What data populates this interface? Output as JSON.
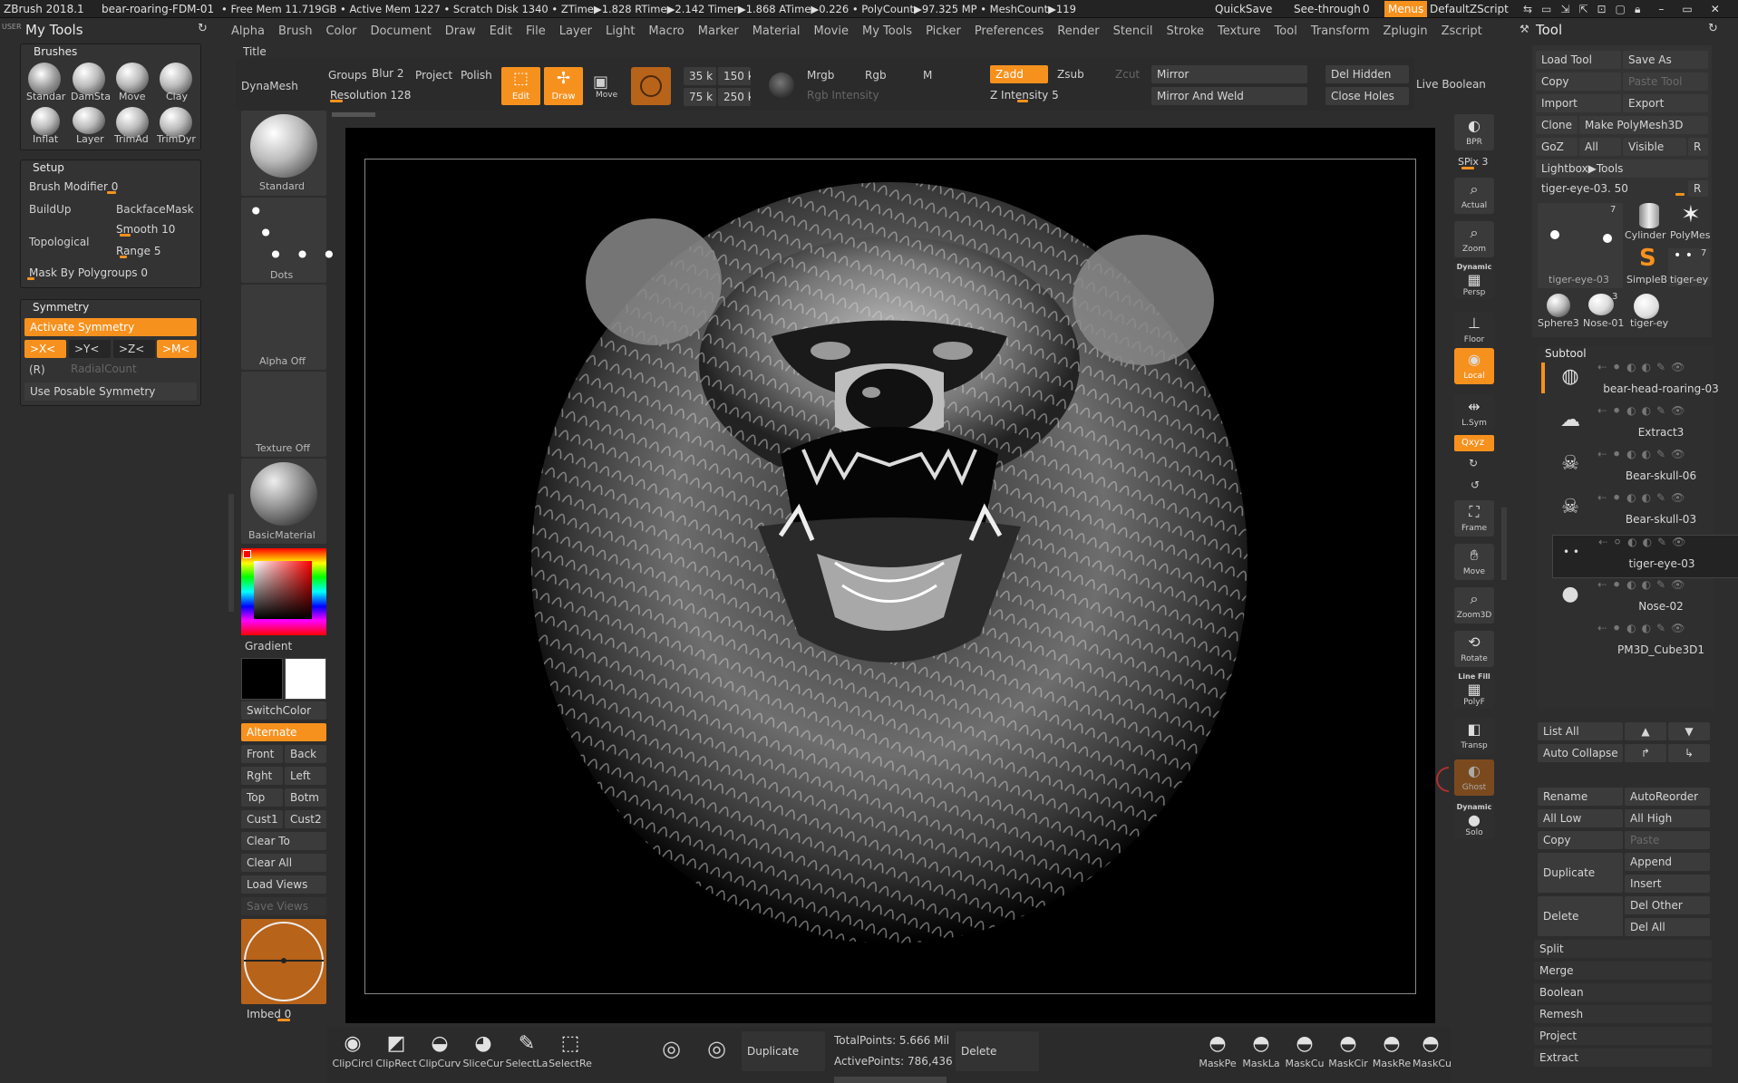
{
  "titlebar": {
    "app": "ZBrush 2018.1",
    "doc": "bear-roaring-FDM-01",
    "stats": "• Free Mem 11.719GB • Active Mem 1227 • Scratch Disk 1340 • ZTime▶1.828 RTime▶2.142 Timer▶1.868 ATime▶0.226 • PolyCount▶97.325 MP • MeshCount▶119",
    "quicksave": "QuickSave",
    "seethrough": "See-through",
    "seethrough_val": "0",
    "menus": "Menus",
    "script": "DefaultZScript"
  },
  "menu": [
    "Alpha",
    "Brush",
    "Color",
    "Document",
    "Draw",
    "Edit",
    "File",
    "Layer",
    "Light",
    "Macro",
    "Marker",
    "Material",
    "Movie",
    "My Tools",
    "Picker",
    "Preferences",
    "Render",
    "Stencil",
    "Stroke",
    "Texture",
    "Tool",
    "Transform",
    "Zplugin",
    "Zscript"
  ],
  "left": {
    "user": "USER",
    "title": "My Tools",
    "brushes_hdr": "Brushes",
    "brushes": [
      "Standar",
      "DamSta",
      "Move",
      "Clay",
      "Inflat",
      "Layer",
      "TrimAd",
      "TrimDyr"
    ],
    "setup_hdr": "Setup",
    "brush_modifier": "Brush Modifier 0",
    "buildup": "BuildUp",
    "backface": "BackfaceMask",
    "topological": "Topological",
    "smooth": "Smooth 10",
    "range": "Range 5",
    "mask_by_poly": "Mask By Polygroups 0",
    "sym_hdr": "Symmetry",
    "activate_sym": "Activate Symmetry",
    "x": ">X<",
    "y": ">Y<",
    "z": ">Z<",
    "m": ">M<",
    "r": "(R)",
    "radial": "RadialCount",
    "posable": "Use Posable Symmetry"
  },
  "top": {
    "title": "Title",
    "dynamesh": "DynaMesh",
    "groups": "Groups",
    "blur": "Blur 2",
    "project": "Project",
    "polish": "Polish",
    "resolution": "Resolution 128",
    "edit": "Edit",
    "draw": "Draw",
    "move": "Move",
    "p35k": "35 k",
    "p150k": "150 k",
    "p75k": "75 k",
    "p250k": "250 k",
    "mrgb": "Mrgb",
    "rgb": "Rgb",
    "m": "M",
    "rgb_intensity": "Rgb Intensity",
    "zadd": "Zadd",
    "zsub": "Zsub",
    "zcut": "Zcut",
    "z_intensity": "Z Intensity 5",
    "mirror": "Mirror",
    "mirror_weld": "Mirror And Weld",
    "del_hidden": "Del Hidden",
    "close_holes": "Close Holes",
    "live_boolean": "Live Boolean"
  },
  "shelf": {
    "standard": "Standard",
    "dots": "Dots",
    "alpha_off": "Alpha Off",
    "texture_off": "Texture Off",
    "material": "BasicMaterial",
    "gradient": "Gradient",
    "switchcolor": "SwitchColor",
    "alternate": "Alternate",
    "front": "Front",
    "back": "Back",
    "rght": "Rght",
    "left": "Left",
    "top": "Top",
    "botm": "Botm",
    "cust1": "Cust1",
    "cust2": "Cust2",
    "clear_to": "Clear To",
    "clear_all": "Clear All",
    "load_views": "Load Views",
    "save_views": "Save Views",
    "imbed": "Imbed 0"
  },
  "right_tools": {
    "bpr": "BPR",
    "spix": "SPix 3",
    "actual": "Actual",
    "zoom": "Zoom",
    "persp": "Persp",
    "dynamic": "Dynamic",
    "floor": "Floor",
    "local": "Local",
    "lsym": "L.Sym",
    "xyz": "Qxyz",
    "frame": "Frame",
    "move": "Move",
    "zoom3d": "Zoom3D",
    "rotate": "Rotate",
    "linefill": "Line Fill",
    "polyf": "PolyF",
    "transp": "Transp",
    "ghost": "Ghost",
    "solo": "Solo",
    "dynamic2": "Dynamic"
  },
  "tool": {
    "title": "Tool",
    "load": "Load Tool",
    "save": "Save As",
    "copy": "Copy",
    "paste": "Paste Tool",
    "import": "Import",
    "export": "Export",
    "clone": "Clone",
    "make_poly": "Make PolyMesh3D",
    "goz": "GoZ",
    "all": "All",
    "visible": "Visible",
    "r": "R",
    "lightbox": "Lightbox▶Tools",
    "current": "tiger-eye-03. 50",
    "thumbs": [
      "tiger-eye-03",
      "Cylinder",
      "PolyMes",
      "SimpleB",
      "tiger-ey",
      "Sphere3",
      "Nose-01",
      "tiger-ey"
    ],
    "count1": "7",
    "count2": "7",
    "count3": "3",
    "subtool_hdr": "Subtool",
    "subtools": [
      "bear-head-roaring-03",
      "Extract3",
      "Bear-skull-06",
      "Bear-skull-03",
      "tiger-eye-03",
      "Nose-02",
      "PM3D_Cube3D1"
    ],
    "list_all": "List All",
    "auto_collapse": "Auto Collapse",
    "rename": "Rename",
    "autoreorder": "AutoReorder",
    "all_low": "All Low",
    "all_high": "All High",
    "paste2": "Paste",
    "duplicate": "Duplicate",
    "append": "Append",
    "insert": "Insert",
    "delete": "Delete",
    "del_other": "Del Other",
    "del_all": "Del All",
    "split": "Split",
    "merge": "Merge",
    "boolean": "Boolean",
    "remesh": "Remesh",
    "project": "Project",
    "extract": "Extract"
  },
  "bottom": {
    "tools": [
      "ClipCircl",
      "ClipRect",
      "ClipCurv",
      "SliceCur",
      "SelectLa",
      "SelectRe"
    ],
    "duplicate": "Duplicate",
    "total": "TotalPoints: 5.666 Mil",
    "active": "ActivePoints: 786,436",
    "delete": "Delete",
    "masks": [
      "MaskPe",
      "MaskLa",
      "MaskCu",
      "MaskCir",
      "MaskRe",
      "MaskCu"
    ]
  },
  "colors": {
    "accent": "#f7911e"
  }
}
